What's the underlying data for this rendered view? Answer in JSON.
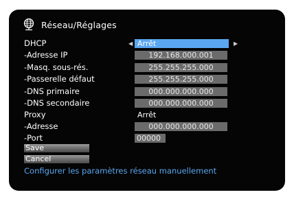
{
  "header": {
    "title": "Réseau/Réglages",
    "icon": "globe-network-icon"
  },
  "rows": [
    {
      "label": "DHCP",
      "value": "Arrêt"
    },
    {
      "label": "-Adresse IP",
      "value": "192.168.000.001"
    },
    {
      "label": "-Masq. sous-rés.",
      "value": "255.255.255.000"
    },
    {
      "label": "-Passerelle défaut",
      "value": "255.255.255.000"
    },
    {
      "label": "-DNS primaire",
      "value": "000.000.000.000"
    },
    {
      "label": "-DNS secondaire",
      "value": "000.000.000.000"
    },
    {
      "label": "Proxy",
      "value": "Arrêt"
    },
    {
      "label": "-Adresse",
      "value": "000.000.000.000"
    },
    {
      "label": "-Port",
      "value": "00000"
    }
  ],
  "buttons": {
    "save": "Save",
    "cancel": "Cancel"
  },
  "hint": "Configurer les paramètres réseau manuellement",
  "colors": {
    "selection": "#5aa7f0",
    "field": "#6b6b6b",
    "hint": "#5aa7f0"
  }
}
